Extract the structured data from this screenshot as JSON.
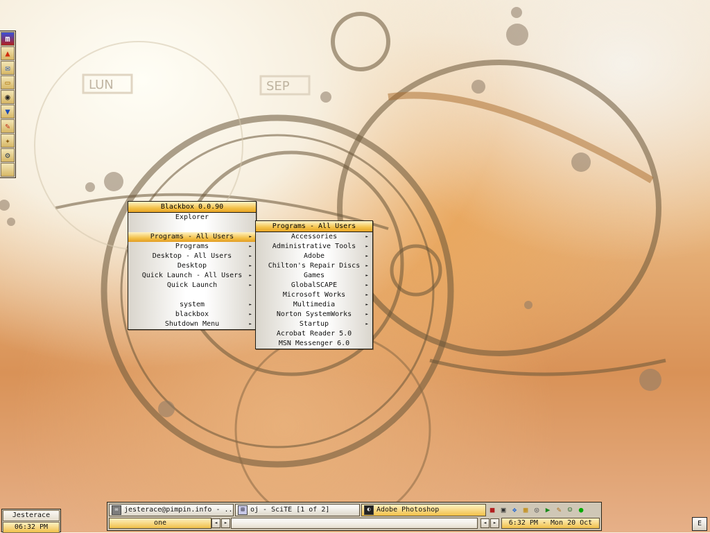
{
  "root_menu": {
    "title": "Blackbox 0.0.90",
    "items": [
      {
        "label": "Explorer"
      },
      {
        "label": ""
      },
      {
        "label": "Programs - All Users",
        "submenu": true,
        "selected": true
      },
      {
        "label": "Programs",
        "submenu": true
      },
      {
        "label": "Desktop - All Users",
        "submenu": true
      },
      {
        "label": "Desktop",
        "submenu": true
      },
      {
        "label": "Quick Launch - All Users",
        "submenu": true
      },
      {
        "label": "Quick Launch",
        "submenu": true
      },
      {
        "label": ""
      },
      {
        "label": "system",
        "submenu": true
      },
      {
        "label": "blackbox",
        "submenu": true
      },
      {
        "label": "Shutdown Menu",
        "submenu": true
      }
    ]
  },
  "sub_menu": {
    "title": "Programs - All Users",
    "items": [
      {
        "label": "Accessories",
        "submenu": true
      },
      {
        "label": "Administrative Tools",
        "submenu": true
      },
      {
        "label": "Adobe",
        "submenu": true
      },
      {
        "label": "Chilton's Repair Discs",
        "submenu": true
      },
      {
        "label": "Games",
        "submenu": true
      },
      {
        "label": "GlobalSCAPE",
        "submenu": true
      },
      {
        "label": "Microsoft Works",
        "submenu": true
      },
      {
        "label": "Multimedia",
        "submenu": true
      },
      {
        "label": "Norton SystemWorks",
        "submenu": true
      },
      {
        "label": "Startup",
        "submenu": true
      },
      {
        "label": "Acrobat Reader 5.0",
        "submenu": false
      },
      {
        "label": "MSN Messenger 6.0",
        "submenu": false
      }
    ]
  },
  "arrow_glyph": "►",
  "dock": {
    "icons": [
      "app-m-icon",
      "flame-icon",
      "mail-icon",
      "folder-icon",
      "eye-icon",
      "filter-icon",
      "pencil-icon",
      "wrench-icon",
      "tools-icon",
      "empty-slot"
    ]
  },
  "clock_box": {
    "user": "Jesterace",
    "time": "06:32 PM"
  },
  "taskbar": {
    "tasks": [
      {
        "label": "jesterace@pimpin.info - ...",
        "icon": "mail-icon",
        "active": false
      },
      {
        "label": "oj - SciTE [1 of 2]",
        "icon": "scite-icon",
        "active": false
      },
      {
        "label": "Adobe Photoshop",
        "icon": "photoshop-icon",
        "active": true
      }
    ],
    "tray_icons": [
      "messenger-icon",
      "tv-icon",
      "network-icon",
      "monitor-icon",
      "cd-icon",
      "media-icon",
      "pencil-icon",
      "user-icon",
      "traffic-light-icon"
    ],
    "workspace": "one",
    "datetime": "6:32 PM - Mon 20 Oct",
    "left_glyph": "◄",
    "right_glyph": "►"
  },
  "slit_button": "E",
  "colors": {
    "accent": "#f3c24a",
    "frame": "#1e1a10"
  }
}
